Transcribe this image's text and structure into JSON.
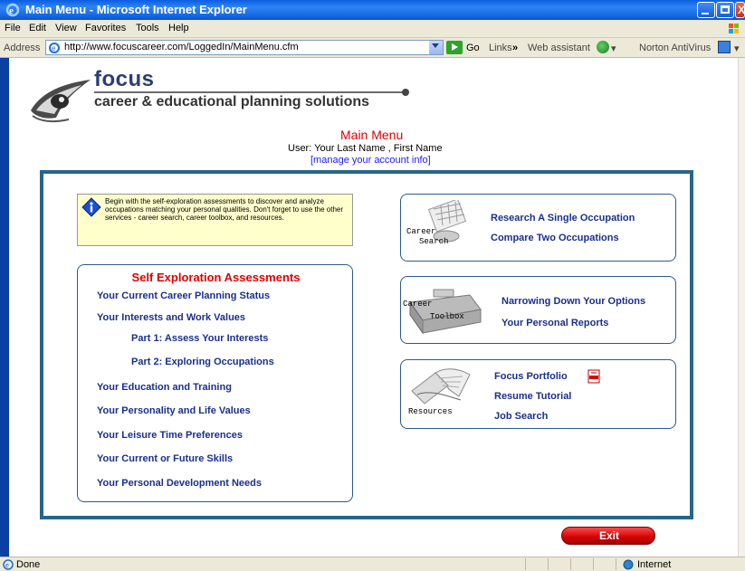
{
  "window": {
    "title": "Main Menu - Microsoft Internet Explorer"
  },
  "menubar": {
    "items": [
      "File",
      "Edit",
      "View",
      "Favorites",
      "Tools",
      "Help"
    ]
  },
  "addressbar": {
    "label": "Address",
    "url": "http://www.focuscareer.com/LoggedIn/MainMenu.cfm",
    "go_label": "Go",
    "links_label": "Links",
    "chevron": "»",
    "web_assistant": "Web assistant",
    "norton": "Norton AntiVirus"
  },
  "logo": {
    "name": "focus",
    "tagline": "career & educational planning solutions"
  },
  "header": {
    "title": "Main Menu",
    "user": "User: Your Last Name , First Name",
    "manage_link": "[manage your account info]"
  },
  "info": {
    "text": "Begin with the self-exploration assessments to discover and analyze occupations matching your personal qualities. Don't forget to use the other services - career search, career toolbox, and resources."
  },
  "self_exploration": {
    "title": "Self Exploration Assessments",
    "links": [
      "Your Current Career Planning Status",
      "Your Interests and Work Values",
      "Part 1: Assess Your Interests",
      "Part 2: Exploring Occupations",
      "Your Education and Training",
      "Your Personality and Life Values",
      "Your Leisure Time Preferences",
      "Your Current or Future Skills",
      "Your Personal Development Needs"
    ]
  },
  "career_search": {
    "image_label_1": "Career",
    "image_label_2": "Search",
    "links": [
      "Research A Single Occupation",
      "Compare Two Occupations"
    ]
  },
  "career_toolbox": {
    "image_label_1": "Career",
    "image_label_2": "Toolbox",
    "links": [
      "Narrowing Down Your Options",
      "Your Personal Reports"
    ]
  },
  "resources": {
    "image_label": "Resources",
    "links": [
      "Focus Portfolio",
      "Resume Tutorial",
      "Job Search"
    ]
  },
  "exit": {
    "label": "Exit"
  },
  "statusbar": {
    "status": "Done",
    "zone": "Internet"
  },
  "colors": {
    "title_bar": "#1a6fe8",
    "frame_border": "#27658b",
    "heading_red": "#e00000",
    "link_blue": "#1a2f8c",
    "info_bg": "#ffffcc"
  }
}
